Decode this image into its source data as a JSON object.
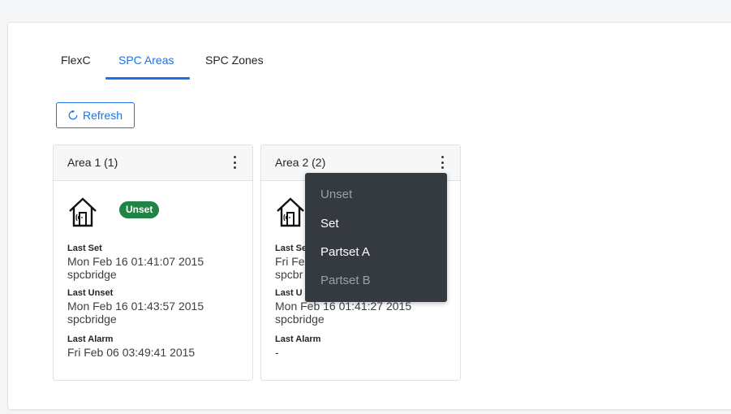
{
  "tabs": [
    {
      "label": "FlexC",
      "active": false
    },
    {
      "label": "SPC Areas",
      "active": true
    },
    {
      "label": "SPC Zones",
      "active": false
    }
  ],
  "toolbar": {
    "refresh_label": "Refresh",
    "refresh_icon": "refresh-icon"
  },
  "colors": {
    "accent": "#1a73e8",
    "badge_unset": "#1e8544",
    "dropdown_bg": "#343a40"
  },
  "areas": [
    {
      "title": "Area 1 (1)",
      "status": "Unset",
      "icon": "house-wireless-icon",
      "last_set_label": "Last Set",
      "last_set_time": "Mon Feb 16 01:41:07 2015",
      "last_set_user": "spcbridge",
      "last_unset_label": "Last Unset",
      "last_unset_time": "Mon Feb 16 01:43:57 2015",
      "last_unset_user": "spcbridge",
      "last_alarm_label": "Last Alarm",
      "last_alarm_time": "Fri Feb 06 03:49:41 2015"
    },
    {
      "title": "Area 2 (2)",
      "icon": "house-wireless-icon",
      "last_set_label": "Last Se",
      "last_set_time": "Fri Fe",
      "last_set_user": "spcbr",
      "last_unset_label": "Last U",
      "last_unset_time": "Mon Feb 16 01:41:27 2015",
      "last_unset_user": "spcbridge",
      "last_alarm_label": "Last Alarm",
      "last_alarm_time": "-"
    }
  ],
  "dropdown": {
    "items": [
      {
        "label": "Unset",
        "enabled": false
      },
      {
        "label": "Set",
        "enabled": true
      },
      {
        "label": "Partset A",
        "enabled": true
      },
      {
        "label": "Partset B",
        "enabled": false
      }
    ]
  }
}
